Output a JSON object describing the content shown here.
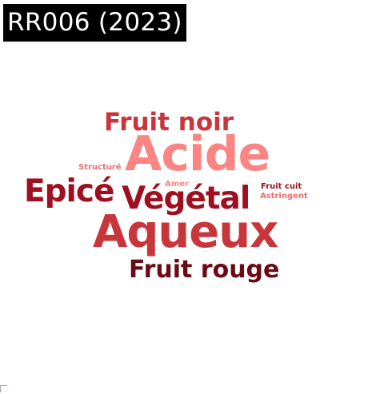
{
  "title": "RR006 (2023)",
  "words": {
    "fruit_noir": {
      "text": "Fruit noir",
      "color": "#c8363c"
    },
    "acide": {
      "text": "Acide",
      "color": "#fb8583"
    },
    "structure": {
      "text": "Structuré",
      "color": "#ea6d6d"
    },
    "amer": {
      "text": "Amer",
      "color": "#fb8583"
    },
    "fruit_cuit": {
      "text": "Fruit cuit",
      "color": "#9e1020"
    },
    "astringent": {
      "text": "Astringent",
      "color": "#ea6d6d"
    },
    "epice": {
      "text": "Epicé",
      "color": "#9e1020"
    },
    "vegetal": {
      "text": "Végétal",
      "color": "#9e1020"
    },
    "aqueux": {
      "text": "Aqueux",
      "color": "#c8363c"
    },
    "fruit_rouge": {
      "text": "Fruit rouge",
      "color": "#6b0a14"
    }
  }
}
